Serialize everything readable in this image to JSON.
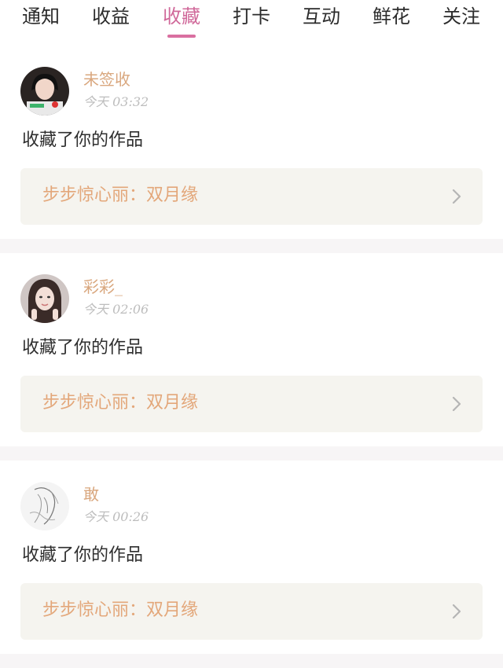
{
  "tabs": [
    {
      "label": "通知"
    },
    {
      "label": "收益"
    },
    {
      "label": "收藏",
      "active": true
    },
    {
      "label": "打卡"
    },
    {
      "label": "互动"
    },
    {
      "label": "鲜花"
    },
    {
      "label": "关注"
    }
  ],
  "colors": {
    "active_tab": "#d0699a",
    "user_name": "#d9a77e",
    "work_title": "#e3a77a",
    "link_bg": "#f5f4ef"
  },
  "notifications": [
    {
      "user": "未签收",
      "time": "今天 03:32",
      "action": "收藏了你的作品",
      "work": "步步惊心丽：双月缘",
      "avatar_icon": "user-avatar-photo"
    },
    {
      "user": "彩彩_",
      "time": "今天 02:06",
      "action": "收藏了你的作品",
      "work": "步步惊心丽：双月缘",
      "avatar_icon": "user-avatar-photo"
    },
    {
      "user": "敢",
      "time": "今天 00:26",
      "action": "收藏了你的作品",
      "work": "步步惊心丽：双月缘",
      "avatar_icon": "user-avatar-sketch"
    }
  ]
}
